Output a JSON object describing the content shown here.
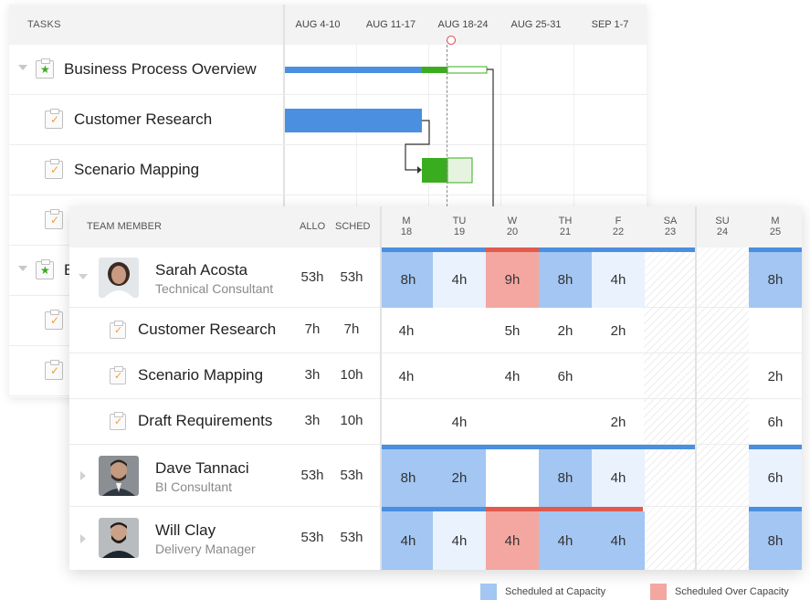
{
  "gantt": {
    "tasks_header": "TASKS",
    "weeks": [
      "AUG  4-10",
      "AUG 11-17",
      "AUG 18-24",
      "AUG 25-31",
      "SEP 1-7"
    ],
    "rows": [
      {
        "name": "Business Process Overview",
        "type": "group"
      },
      {
        "name": "Customer Research",
        "type": "task"
      },
      {
        "name": "Scenario Mapping",
        "type": "task"
      },
      {
        "name": "",
        "type": "task"
      },
      {
        "name": "B",
        "type": "group"
      },
      {
        "name": "",
        "type": "task"
      },
      {
        "name": "",
        "type": "task"
      }
    ],
    "colors": {
      "bar_blue": "#4a8fe0",
      "bar_green": "#3aad1f",
      "today": "#e04545"
    }
  },
  "resource": {
    "headers": {
      "member": "TEAM MEMBER",
      "allo": "ALLO",
      "sched": "SCHED"
    },
    "days": [
      {
        "dow": "M",
        "date": "18"
      },
      {
        "dow": "TU",
        "date": "19"
      },
      {
        "dow": "W",
        "date": "20"
      },
      {
        "dow": "TH",
        "date": "21"
      },
      {
        "dow": "F",
        "date": "22"
      },
      {
        "dow": "SA",
        "date": "23"
      },
      {
        "dow": "SU",
        "date": "24"
      },
      {
        "dow": "M",
        "date": "25"
      }
    ],
    "people": [
      {
        "name": "Sarah Acosta",
        "role": "Technical Consultant",
        "allo": "53h",
        "sched": "53h",
        "cells": [
          "8h",
          "4h",
          "9h",
          "8h",
          "4h",
          "",
          "",
          "8h"
        ]
      },
      {
        "name": "Dave Tannaci",
        "role": "BI Consultant",
        "allo": "53h",
        "sched": "53h",
        "cells": [
          "8h",
          "2h",
          "",
          "8h",
          "4h",
          "",
          "",
          "6h"
        ]
      },
      {
        "name": "Will Clay",
        "role": "Delivery Manager",
        "allo": "53h",
        "sched": "53h",
        "cells": [
          "4h",
          "4h",
          "4h",
          "4h",
          "4h",
          "",
          "",
          "8h"
        ]
      }
    ],
    "subtasks": [
      {
        "name": "Customer Research",
        "allo": "7h",
        "sched": "7h",
        "cells": [
          "4h",
          "",
          "5h",
          "2h",
          "2h",
          "",
          "",
          ""
        ]
      },
      {
        "name": "Scenario Mapping",
        "allo": "3h",
        "sched": "10h",
        "cells": [
          "4h",
          "",
          "4h",
          "6h",
          "",
          "",
          "",
          "2h"
        ]
      },
      {
        "name": "Draft Requirements",
        "allo": "3h",
        "sched": "10h",
        "cells": [
          "",
          "4h",
          "",
          "",
          "2h",
          "",
          "",
          "6h"
        ]
      }
    ],
    "colors": {
      "capacity": "#a3c6f2",
      "light": "#e9f2fd",
      "over": "#f3a7a0",
      "bar_blue": "#4a8fe0",
      "bar_red": "#e05a4e"
    }
  },
  "legend": {
    "at_capacity": "Scheduled at Capacity",
    "over_capacity": "Scheduled Over Capacity"
  }
}
